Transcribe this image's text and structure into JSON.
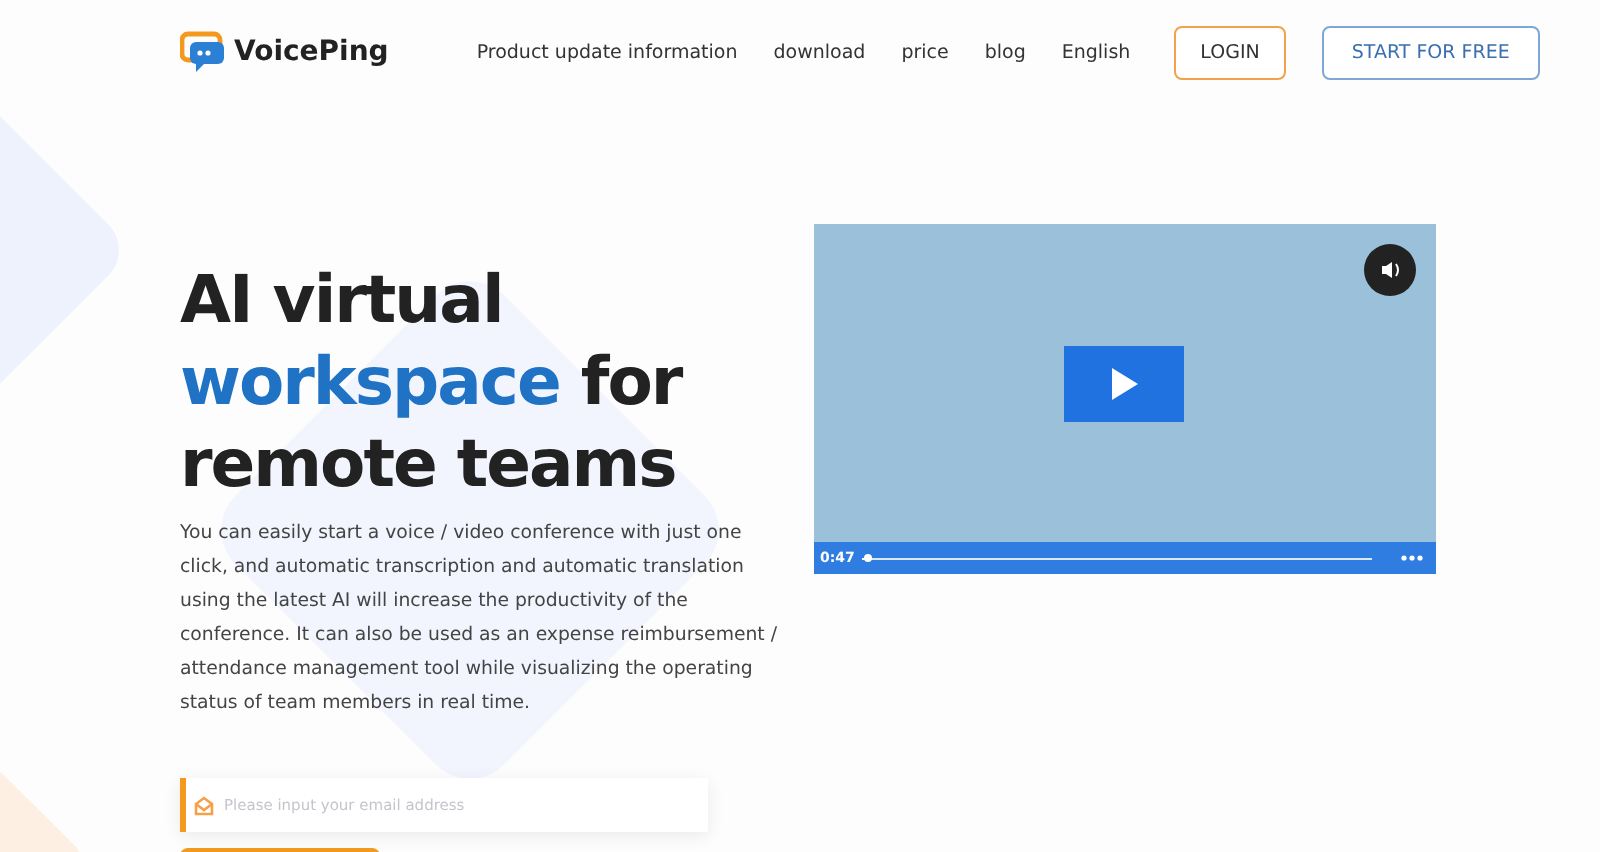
{
  "header": {
    "logo": "VoicePing",
    "nav": [
      "Product update information",
      "download",
      "price",
      "blog",
      "English"
    ],
    "login_button": "LOGIN",
    "start_button": "START FOR FREE"
  },
  "hero": {
    "headline": [
      {
        "text": "AI virtual ",
        "highlight": false
      },
      {
        "text": "workspace",
        "highlight": true
      },
      {
        "text": " for remote teams",
        "highlight": false
      }
    ],
    "description": "You can easily start a voice / video conference with just one click, and automatic transcription and automatic translation using the latest AI will increase the productivity of the conference. It can also be used as an expense reimbursement / attendance management tool while visualizing the operating status of team members in real time.",
    "email_field": {
      "placeholder": "Please input your email address"
    }
  },
  "video": {
    "time": "0:47",
    "level": 0.01
  }
}
